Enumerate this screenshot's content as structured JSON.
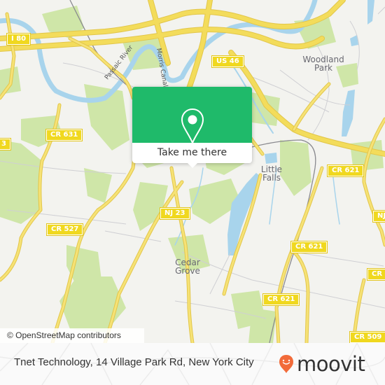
{
  "map": {
    "colors": {
      "background": "#f3f3ef",
      "park": "#cfe6a8",
      "water": "#a8d4ec",
      "road_major": "#f3dc5b",
      "road_casing": "#e6c84a",
      "road_minor": "#c8c8cc",
      "rail": "#888888"
    },
    "shields": [
      {
        "id": "i80",
        "label": "I 80"
      },
      {
        "id": "us46",
        "label": "US 46"
      },
      {
        "id": "cr631",
        "label": "CR 631"
      },
      {
        "id": "cr527",
        "label": "CR 527"
      },
      {
        "id": "nj23",
        "label": "NJ 23"
      },
      {
        "id": "cr621a",
        "label": "CR 621"
      },
      {
        "id": "cr621b",
        "label": "CR 621"
      },
      {
        "id": "cr621c",
        "label": "CR 621"
      },
      {
        "id": "cr509",
        "label": "CR 509"
      },
      {
        "id": "edge-left",
        "label": "3"
      },
      {
        "id": "edge-right-a",
        "label": "NJ"
      },
      {
        "id": "edge-right-b",
        "label": "CR"
      }
    ],
    "places": [
      {
        "id": "woodland-park",
        "lines": [
          "Woodland",
          "Park"
        ]
      },
      {
        "id": "little-falls",
        "lines": [
          "Little",
          "Falls"
        ]
      },
      {
        "id": "cedar-grove",
        "lines": [
          "Cedar",
          "Grove"
        ]
      }
    ],
    "waterway_labels": [
      {
        "id": "passaic-river",
        "label": "Passaic River"
      },
      {
        "id": "morris-canal",
        "label": "Morris Canal"
      }
    ],
    "attribution": "© OpenStreetMap contributors"
  },
  "popup": {
    "accent": "#1fba6a",
    "icon": "map-pin-icon",
    "cta_label": "Take me there"
  },
  "footer": {
    "title": "Tnet Technology, 14 Village Park Rd, New York City",
    "brand": "moovit",
    "brand_color": "#f26b3a"
  }
}
